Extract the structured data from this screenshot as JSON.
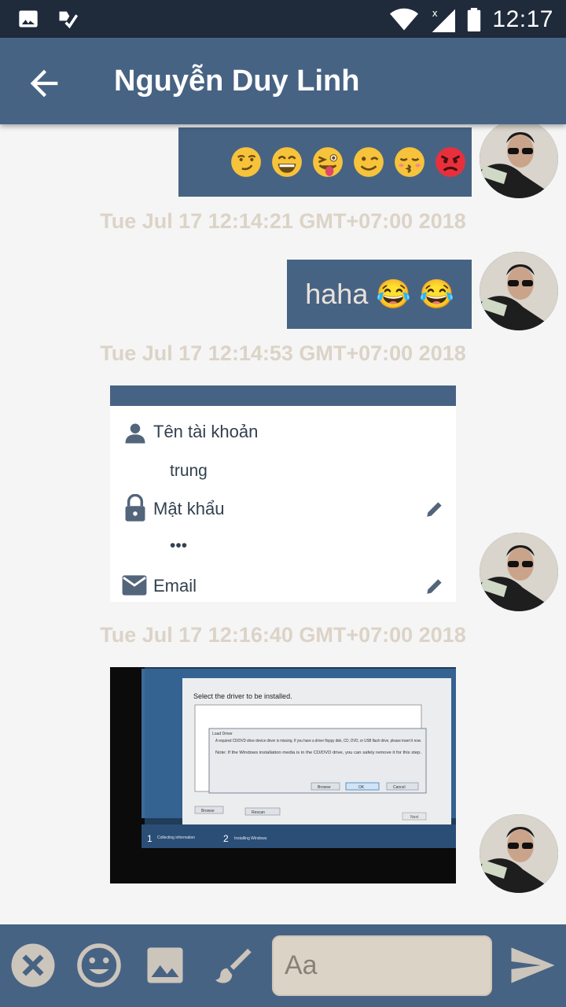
{
  "status_bar": {
    "time": "12:17",
    "icons": [
      "image-icon",
      "check-notification-icon",
      "wifi-icon",
      "signal-icon",
      "battery-icon"
    ]
  },
  "header": {
    "back_icon": "arrow-back-icon",
    "title": "Nguyễn Duy Linh"
  },
  "messages": [
    {
      "type": "emoji",
      "emojis": [
        "smirk-emoji",
        "grin-emoji",
        "tongue-wink-emoji",
        "wink-emoji",
        "kissing-emoji",
        "angry-emoji"
      ],
      "timestamp": "Tue Jul 17 12:14:21 GMT+07:00 2018"
    },
    {
      "type": "text",
      "text": "haha 😂 😂",
      "timestamp": "Tue Jul 17 12:14:53 GMT+07:00 2018"
    },
    {
      "type": "image",
      "content": {
        "account_label": "Tên tài khoản",
        "account_value": "trung",
        "password_label": "Mật khẩu",
        "password_value": "•••",
        "email_label": "Email"
      },
      "timestamp": "Tue Jul 17 12:16:40 GMT+07:00 2018"
    },
    {
      "type": "photo",
      "content": {
        "heading": "Select the driver to be installed.",
        "dialog_title": "Load Driver",
        "dialog_line1": "A required CD/DVD drive device driver is missing. If you have a driver floppy disk, CD, DVD, or USB flash drive, please insert it now.",
        "dialog_line2": "Note: If the Windows installation media is in the CD/DVD drive, you can safely remove it for this step.",
        "browse": "Browse",
        "ok": "OK",
        "cancel": "Cancel",
        "rescan": "Rescan",
        "next": "Next",
        "step1": "Collecting information",
        "step2": "Installing Windows"
      }
    }
  ],
  "composer": {
    "placeholder": "Aa",
    "tools": [
      "close-icon",
      "emoji-icon",
      "image-icon",
      "brush-icon",
      "send-icon"
    ]
  },
  "colors": {
    "primary": "#476384",
    "status_bar": "#1f2a3a",
    "background": "#f5f5f5",
    "timestamp": "#dcd3c7",
    "bubble_text": "#e8e2da",
    "input_bg": "#dcd3c7"
  }
}
